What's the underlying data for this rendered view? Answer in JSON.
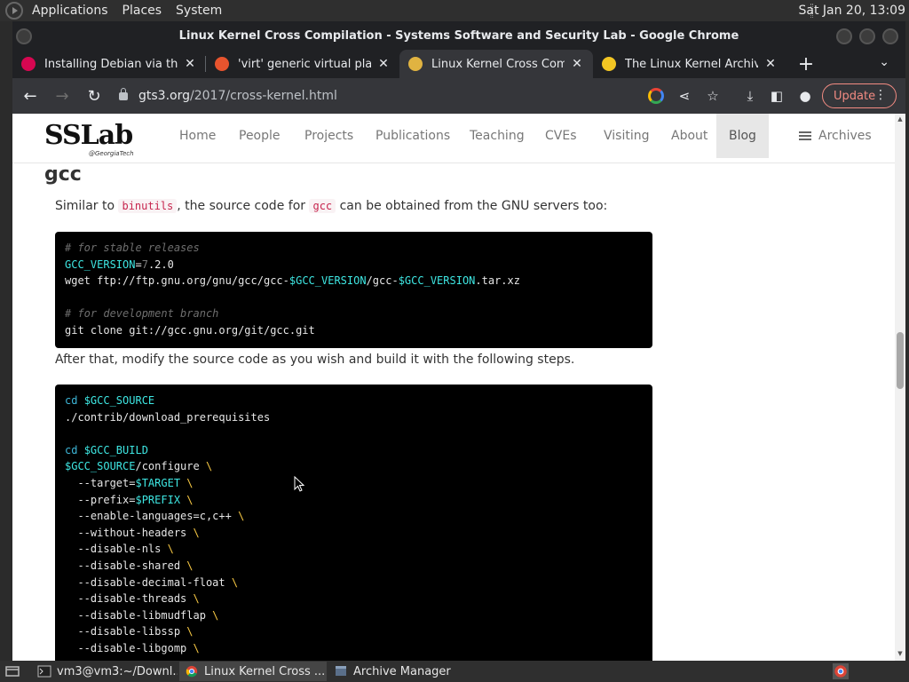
{
  "top_panel": {
    "menus": [
      "Applications",
      "Places",
      "System"
    ],
    "clock": "Sat Jan 20, 13:09"
  },
  "window": {
    "title": "Linux Kernel Cross Compilation - Systems Software and Security Lab - Google Chrome"
  },
  "tabs": [
    {
      "label": "Installing Debian via the In",
      "favicon": "debian-icon",
      "color": "#d70751"
    },
    {
      "label": "'virt' generic virtual platfo",
      "favicon": "qemu-icon",
      "color": "#e8542e"
    },
    {
      "label": "Linux Kernel Cross Compi",
      "favicon": "sslab-icon",
      "color": "#e0b341",
      "active": true
    },
    {
      "label": "The Linux Kernel Archives",
      "favicon": "tux-icon",
      "color": "#f3c623"
    }
  ],
  "toolbar": {
    "url_host": "gts3.org",
    "url_path": "/2017/cross-kernel.html",
    "update_label": "Update"
  },
  "site": {
    "logo_text": "SSLab",
    "logo_sub": "@GeorgiaTech",
    "nav": [
      "Home",
      "People",
      "Projects",
      "Publications",
      "Teaching",
      "CVEs",
      "Visiting",
      "About",
      "Blog",
      "Archives"
    ],
    "active_nav": "Blog"
  },
  "article": {
    "heading": "gcc",
    "para1": {
      "before": "Similar to ",
      "code1": "binutils",
      "middle": ", the source code for ",
      "code2": "gcc",
      "after": " can be obtained from the GNU servers too:"
    },
    "code1": [
      [
        {
          "t": "# for stable releases",
          "c": "c-comment"
        }
      ],
      [
        {
          "t": "GCC_VERSION",
          "c": "c-var"
        },
        {
          "t": "="
        },
        {
          "t": "7",
          "c": "c-num"
        },
        {
          "t": ".2.0"
        }
      ],
      [
        {
          "t": "wget ftp://ftp.gnu.org/gnu/gcc/gcc-"
        },
        {
          "t": "$GCC_VERSION",
          "c": "c-var"
        },
        {
          "t": "/gcc-"
        },
        {
          "t": "$GCC_VERSION",
          "c": "c-var"
        },
        {
          "t": ".tar.xz"
        }
      ],
      [],
      [
        {
          "t": "# for development branch",
          "c": "c-comment"
        }
      ],
      [
        {
          "t": "git clone git://gcc.gnu.org/git/gcc.git"
        }
      ]
    ],
    "para2": "After that, modify the source code as you wish and build it with the following steps.",
    "code2": [
      [
        {
          "t": "cd",
          "c": "c-kw"
        },
        {
          "t": " "
        },
        {
          "t": "$GCC_SOURCE",
          "c": "c-var"
        }
      ],
      [
        {
          "t": "./contrib/download_prerequisites"
        }
      ],
      [],
      [
        {
          "t": "cd",
          "c": "c-kw"
        },
        {
          "t": " "
        },
        {
          "t": "$GCC_BUILD",
          "c": "c-var"
        }
      ],
      [
        {
          "t": "$GCC_SOURCE",
          "c": "c-var"
        },
        {
          "t": "/configure "
        },
        {
          "t": "\\",
          "c": "c-esc"
        }
      ],
      [
        {
          "t": "  --target="
        },
        {
          "t": "$TARGET",
          "c": "c-var"
        },
        {
          "t": " "
        },
        {
          "t": "\\",
          "c": "c-esc"
        }
      ],
      [
        {
          "t": "  --prefix="
        },
        {
          "t": "$PREFIX",
          "c": "c-var"
        },
        {
          "t": " "
        },
        {
          "t": "\\",
          "c": "c-esc"
        }
      ],
      [
        {
          "t": "  --enable-languages=c,c++ "
        },
        {
          "t": "\\",
          "c": "c-esc"
        }
      ],
      [
        {
          "t": "  --without-headers "
        },
        {
          "t": "\\",
          "c": "c-esc"
        }
      ],
      [
        {
          "t": "  --disable-nls "
        },
        {
          "t": "\\",
          "c": "c-esc"
        }
      ],
      [
        {
          "t": "  --disable-shared "
        },
        {
          "t": "\\",
          "c": "c-esc"
        }
      ],
      [
        {
          "t": "  --disable-decimal-float "
        },
        {
          "t": "\\",
          "c": "c-esc"
        }
      ],
      [
        {
          "t": "  --disable-threads "
        },
        {
          "t": "\\",
          "c": "c-esc"
        }
      ],
      [
        {
          "t": "  --disable-libmudflap "
        },
        {
          "t": "\\",
          "c": "c-esc"
        }
      ],
      [
        {
          "t": "  --disable-libssp "
        },
        {
          "t": "\\",
          "c": "c-esc"
        }
      ],
      [
        {
          "t": "  --disable-libgomp "
        },
        {
          "t": "\\",
          "c": "c-esc"
        }
      ]
    ]
  },
  "taskbar": {
    "tasks": [
      {
        "label": "vm3@vm3:~/Downl...",
        "icon": "terminal-icon"
      },
      {
        "label": "Linux Kernel Cross ...",
        "icon": "chrome-icon",
        "active": true
      },
      {
        "label": "Archive Manager",
        "icon": "archive-manager-icon"
      }
    ]
  }
}
